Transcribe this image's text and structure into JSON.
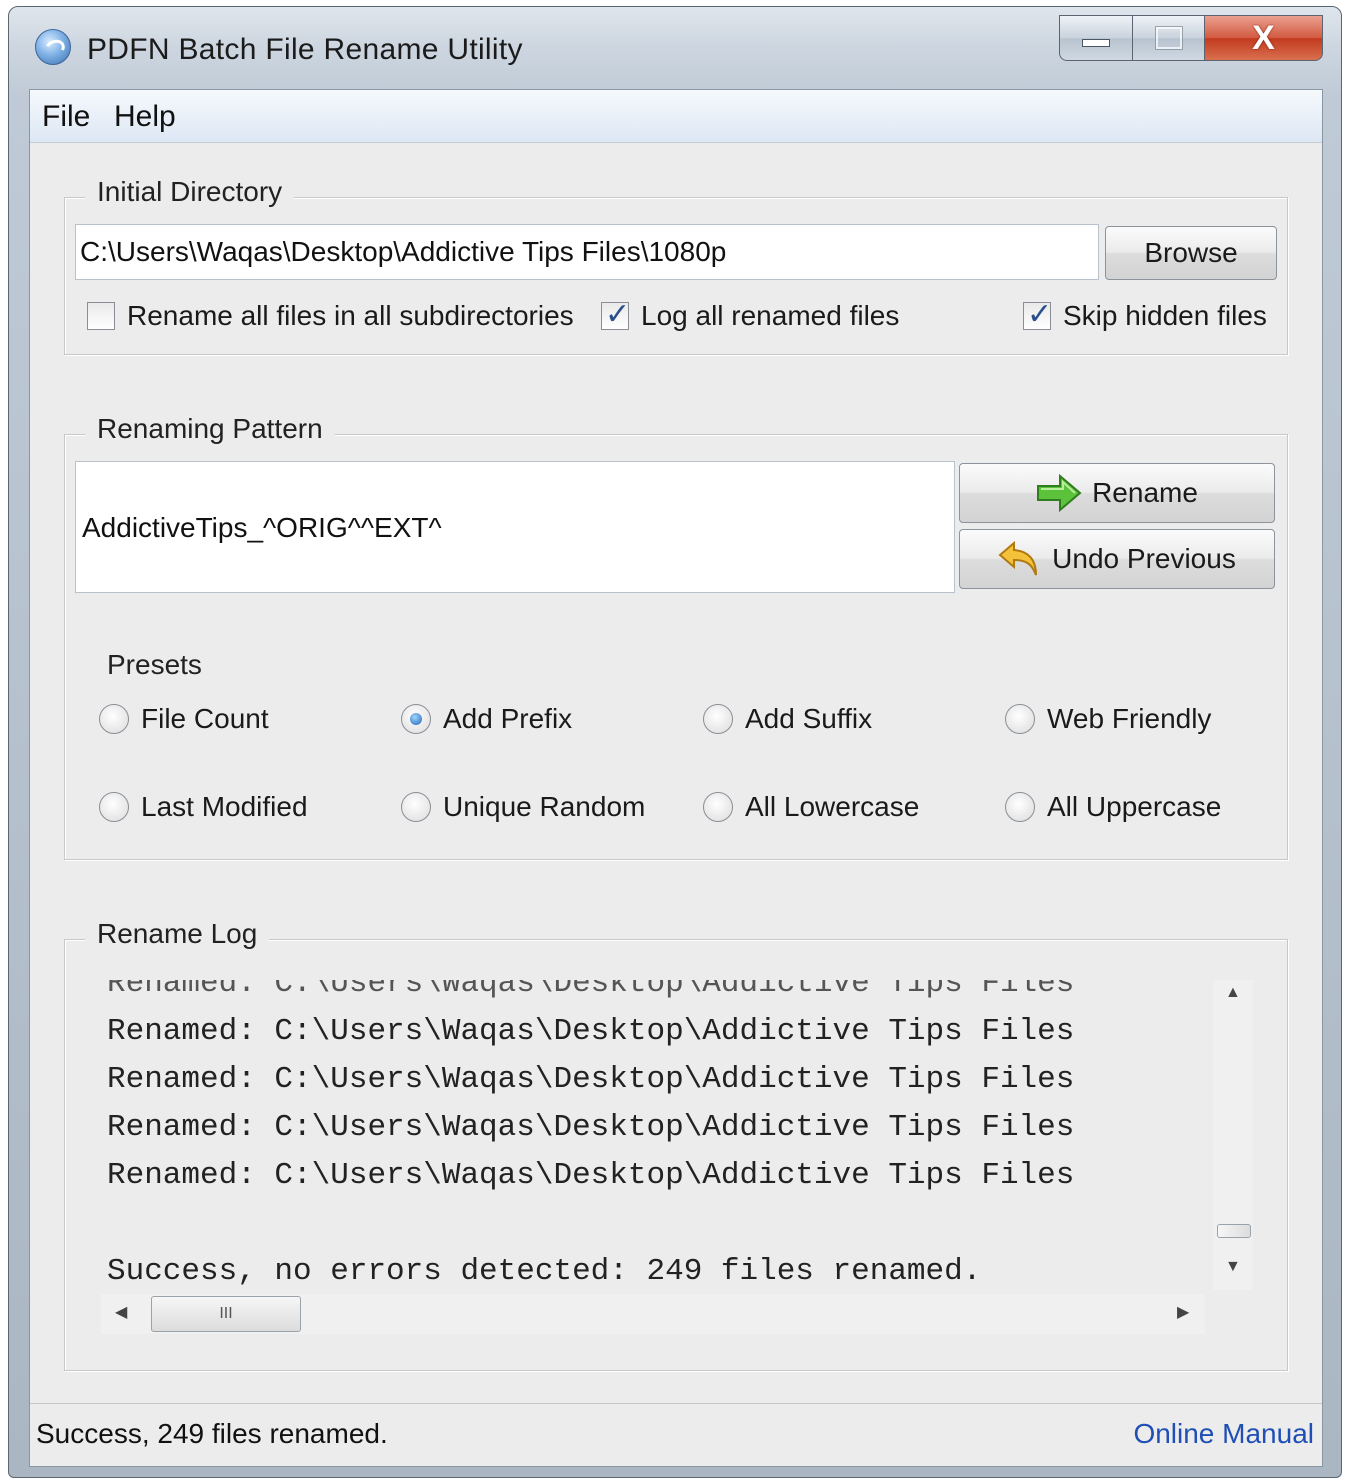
{
  "window": {
    "title": "PDFN Batch File Rename Utility",
    "min_icon": "minimize-icon",
    "max_icon": "maximize-icon",
    "close_icon": "close-icon",
    "close_glyph": "X"
  },
  "menu": {
    "file": "File",
    "help": "Help"
  },
  "initial_directory": {
    "legend": "Initial Directory",
    "path": "C:\\Users\\Waqas\\Desktop\\Addictive Tips Files\\1080p",
    "browse": "Browse",
    "opt_subdirs": {
      "label": "Rename all files in all subdirectories",
      "checked": false
    },
    "opt_log": {
      "label": "Log all renamed files",
      "checked": true
    },
    "opt_hidden": {
      "label": "Skip hidden files",
      "checked": true
    }
  },
  "renaming_pattern": {
    "legend": "Renaming Pattern",
    "pattern": "AddictiveTips_^ORIG^^EXT^",
    "rename": "Rename",
    "rename_icon": "green-arrow-icon",
    "undo": "Undo Previous",
    "undo_icon": "undo-arrow-icon",
    "presets_label": "Presets",
    "presets": [
      {
        "label": "File Count",
        "selected": false
      },
      {
        "label": "Add Prefix",
        "selected": true
      },
      {
        "label": "Add Suffix",
        "selected": false
      },
      {
        "label": "Web Friendly",
        "selected": false
      },
      {
        "label": "Last Modified",
        "selected": false
      },
      {
        "label": "Unique Random",
        "selected": false
      },
      {
        "label": "All Lowercase",
        "selected": false
      },
      {
        "label": "All Uppercase",
        "selected": false
      }
    ]
  },
  "rename_log": {
    "legend": "Rename Log",
    "lines": [
      "Renamed: C:\\Users\\Waqas\\Desktop\\Addictive Tips Files",
      "Renamed: C:\\Users\\Waqas\\Desktop\\Addictive Tips Files",
      "Renamed: C:\\Users\\Waqas\\Desktop\\Addictive Tips Files",
      "Renamed: C:\\Users\\Waqas\\Desktop\\Addictive Tips Files",
      "Renamed: C:\\Users\\Waqas\\Desktop\\Addictive Tips Files"
    ],
    "summary": "Success, no errors detected: 249 files renamed.",
    "hscroll_grip": "III"
  },
  "status": {
    "text": "Success, 249 files renamed.",
    "link": "Online Manual"
  },
  "colors": {
    "accent_link": "#1f4fb5",
    "close_red": "#c23a1e"
  }
}
